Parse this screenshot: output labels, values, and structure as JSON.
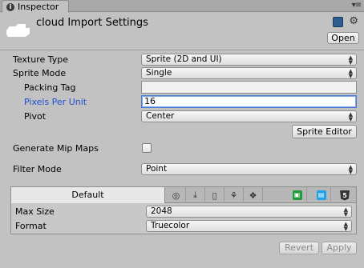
{
  "window": {
    "tab_title": "Inspector",
    "tab_icon": "i",
    "tab_menu_glyph": "▾≡"
  },
  "header": {
    "title": "cloud Import Settings",
    "open_label": "Open"
  },
  "properties": {
    "texture_type": {
      "label": "Texture Type",
      "value": "Sprite (2D and UI)"
    },
    "sprite_mode": {
      "label": "Sprite Mode",
      "value": "Single"
    },
    "packing_tag": {
      "label": "Packing Tag",
      "value": ""
    },
    "pixels_per_unit": {
      "label": "Pixels Per Unit",
      "value": "16"
    },
    "pivot": {
      "label": "Pivot",
      "value": "Center"
    },
    "sprite_editor_label": "Sprite Editor",
    "generate_mip_maps": {
      "label": "Generate Mip Maps",
      "checked": false
    },
    "filter_mode": {
      "label": "Filter Mode",
      "value": "Point"
    }
  },
  "platform": {
    "default_tab": "Default",
    "tabs": [
      {
        "name": "web-globe-icon",
        "glyph": "◎"
      },
      {
        "name": "standalone-download-icon",
        "glyph": "⤓"
      },
      {
        "name": "ios-phone-icon",
        "glyph": "▯"
      },
      {
        "name": "android-icon",
        "glyph": "⚘"
      },
      {
        "name": "blackberry-icon",
        "glyph": "❖"
      },
      {
        "name": "xbox-store-icon",
        "glyph": "▣"
      },
      {
        "name": "windows-store-icon",
        "glyph": "▤"
      },
      {
        "name": "html5-icon",
        "glyph": "5"
      }
    ],
    "max_size": {
      "label": "Max Size",
      "value": "2048"
    },
    "format": {
      "label": "Format",
      "value": "Truecolor"
    }
  },
  "footer": {
    "revert_label": "Revert",
    "apply_label": "Apply"
  },
  "colors": {
    "focus_label": "#1f4fd0",
    "panel_bg": "#c2c2c2"
  }
}
